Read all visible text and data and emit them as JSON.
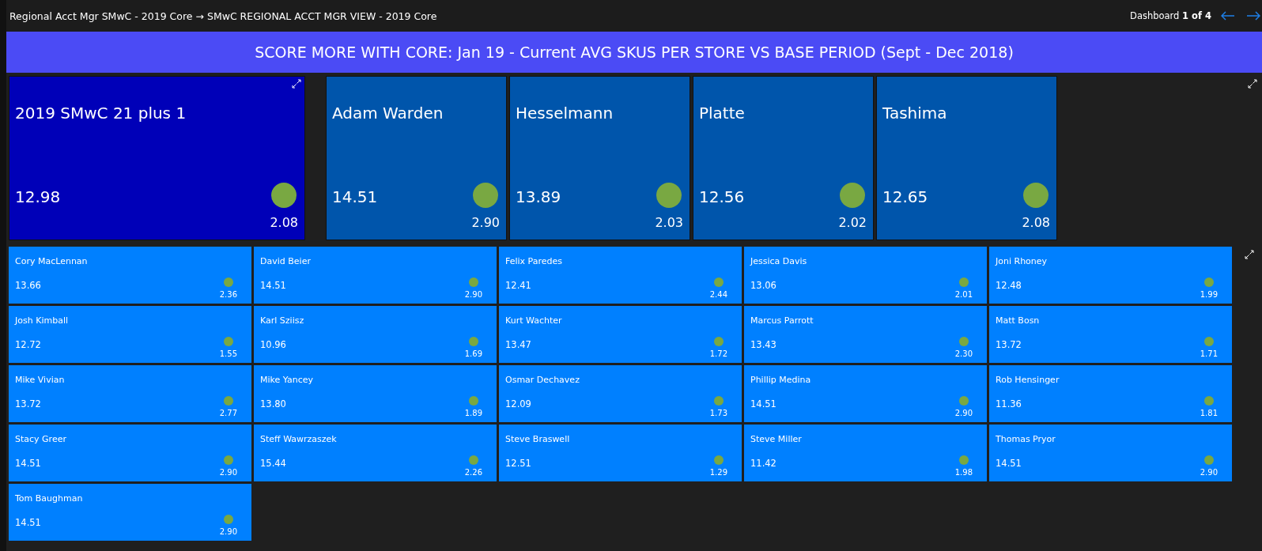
{
  "header": {
    "breadcrumb": "Regional Acct Mgr SMwC - 2019 Core → SMwC REGIONAL ACCT MGR VIEW - 2019 Core",
    "page_prefix": "Dashboard ",
    "page_count": "1 of 4"
  },
  "banner": {
    "title": "SCORE MORE WITH CORE: Jan 19 - Current AVG SKUS PER STORE VS BASE PERIOD (Sept - Dec 2018)"
  },
  "summary_tiles": [
    {
      "kind": "total",
      "name": "2019 SMwC 21 plus 1",
      "value": "12.98",
      "change": "2.08"
    },
    {
      "kind": "group",
      "name": "Adam Warden",
      "value": "14.51",
      "change": "2.90"
    },
    {
      "kind": "group",
      "name": "Hesselmann",
      "value": "13.89",
      "change": "2.03"
    },
    {
      "kind": "group",
      "name": "Platte",
      "value": "12.56",
      "change": "2.02"
    },
    {
      "kind": "group",
      "name": "Tashima",
      "value": "12.65",
      "change": "2.08"
    }
  ],
  "rep_tiles": [
    {
      "name": "Cory MacLennan",
      "value": "13.66",
      "change": "2.36"
    },
    {
      "name": "David Beier",
      "value": "14.51",
      "change": "2.90"
    },
    {
      "name": "Felix Paredes",
      "value": "12.41",
      "change": "2.44"
    },
    {
      "name": "Jessica Davis",
      "value": "13.06",
      "change": "2.01"
    },
    {
      "name": "Joni Rhoney",
      "value": "12.48",
      "change": "1.99"
    },
    {
      "name": "Josh Kimball",
      "value": "12.72",
      "change": "1.55"
    },
    {
      "name": "Karl Sziisz",
      "value": "10.96",
      "change": "1.69"
    },
    {
      "name": "Kurt Wachter",
      "value": "13.47",
      "change": "1.72"
    },
    {
      "name": "Marcus Parrott",
      "value": "13.43",
      "change": "2.30"
    },
    {
      "name": "Matt Bosn",
      "value": "13.72",
      "change": "1.71"
    },
    {
      "name": "Mike Vivian",
      "value": "13.72",
      "change": "2.77"
    },
    {
      "name": "Mike Yancey",
      "value": "13.80",
      "change": "1.89"
    },
    {
      "name": "Osmar Dechavez",
      "value": "12.09",
      "change": "1.73"
    },
    {
      "name": "Phillip Medina",
      "value": "14.51",
      "change": "2.90"
    },
    {
      "name": "Rob Hensinger",
      "value": "11.36",
      "change": "1.81"
    },
    {
      "name": "Stacy Greer",
      "value": "14.51",
      "change": "2.90"
    },
    {
      "name": "Steff Wawrzaszek",
      "value": "15.44",
      "change": "2.26"
    },
    {
      "name": "Steve Braswell",
      "value": "12.51",
      "change": "1.29"
    },
    {
      "name": "Steve Miller",
      "value": "11.42",
      "change": "1.98"
    },
    {
      "name": "Thomas Pryor",
      "value": "14.51",
      "change": "2.90"
    },
    {
      "name": "Tom Baughman",
      "value": "14.51",
      "change": "2.90"
    }
  ]
}
